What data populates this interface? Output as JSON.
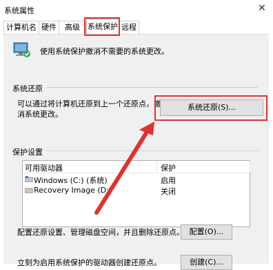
{
  "window": {
    "title": "系统属性",
    "close_glyph": "✕"
  },
  "tabs": [
    {
      "label": "计算机名"
    },
    {
      "label": "硬件"
    },
    {
      "label": "高级"
    },
    {
      "label": "系统保护"
    },
    {
      "label": "远程"
    }
  ],
  "intro": {
    "text": "使用系统保护撤消不需要的系统更改。"
  },
  "restore_section": {
    "heading": "系统还原",
    "text": "可以通过将计算机还原到上一个还原点，撤消系统更改。",
    "button": "系统还原(S)..."
  },
  "protection_section": {
    "heading": "保护设置",
    "columns": [
      "可用驱动器",
      "保护"
    ],
    "rows": [
      {
        "drive": "Windows (C:) (系统)",
        "status": "启用"
      },
      {
        "drive": "Recovery Image (D:)",
        "status": "关闭"
      }
    ]
  },
  "configure": {
    "text": "配置还原设置、管理磁盘空间，并且删除还原点。",
    "button": "配置(O)..."
  },
  "create": {
    "text": "立刻为启用系统保护的驱动器创建还原点。",
    "button": "创建(C)..."
  },
  "annotation_color": "#e0322e"
}
